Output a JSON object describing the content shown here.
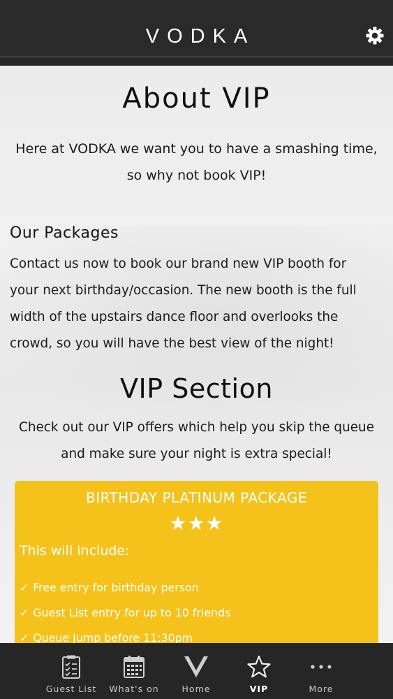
{
  "header": {
    "logo": "VODKA"
  },
  "page": {
    "title": "About VIP",
    "intro_lines": [
      "Here at VODKA we want you to have a smashing time,",
      "so why not book VIP!"
    ],
    "packages_heading": "Our Packages",
    "packages_lines": [
      "Contact us now to book our brand new VIP booth for",
      "your next birthday/occasion. The new booth is the full",
      "width of the upstairs dance floor and overlooks the",
      "crowd, so you will have the best view of the night!"
    ],
    "vip_heading": "VIP Section",
    "vip_lines": [
      "Check out our VIP offers which help you skip the queue",
      "and make sure your night is extra special!"
    ]
  },
  "package": {
    "name": "BIRTHDAY PLATINUM PACKAGE",
    "rating": 3,
    "stars": "★★★",
    "includes_label": "This will include:",
    "check": "✓",
    "items": [
      "Free entry for birthday person",
      "Guest List entry for up to 10 friends",
      "Queue Jump before 11:30pm"
    ]
  },
  "tabs": [
    {
      "label": "Guest List",
      "icon": "clipboard-icon"
    },
    {
      "label": "What's on",
      "icon": "calendar-icon"
    },
    {
      "label": "Home",
      "icon": "vodka-logo-icon"
    },
    {
      "label": "VIP",
      "icon": "star-icon",
      "active": true
    },
    {
      "label": "More",
      "icon": "more-icon"
    }
  ],
  "colors": {
    "accent": "#f5c21b",
    "header": "#2a2a2a",
    "tabbar": "#262626"
  }
}
